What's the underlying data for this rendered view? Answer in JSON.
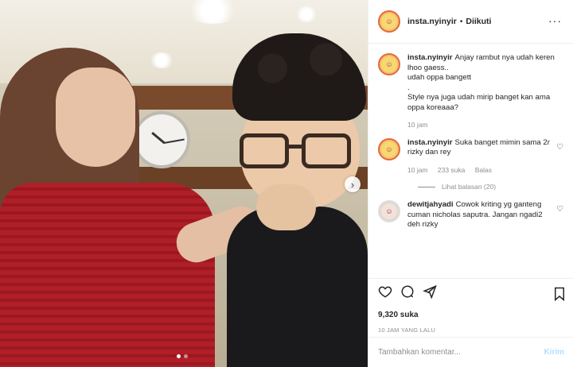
{
  "post": {
    "username": "insta.nyinyir",
    "separator": "•",
    "follow_state": "Diikuti",
    "more_icon": "more-horizontal-icon",
    "caption": "Anjay rambut nya udah keren lhoo gaess..\nudah oppa bangett\n.\nStyle nya juga udah mirip banget kan ama oppa koreaaa?",
    "caption_time": "10 jam",
    "likes": "9,320 suka",
    "posted_ago": "10 JAM YANG LALU"
  },
  "comments": [
    {
      "username": "insta.nyinyir",
      "text": "Suka banget mimin sama 2r rizky dan rey",
      "time": "10 jam",
      "likes": "233 suka",
      "reply_label": "Balas",
      "view_replies": "Lihat balasan (20)"
    },
    {
      "username": "dewitjahyadi",
      "text": "Cowok kriting yg ganteng cuman nicholas saputra. Jangan ngadi2 deh rizky"
    }
  ],
  "composer": {
    "placeholder": "Tambahkan komentar...",
    "post_label": "Kirim"
  },
  "colors": {
    "post_button_disabled": "#b2dffc",
    "secondary_text": "#8e8e8e",
    "dress_red": "#b01f28"
  },
  "icons": [
    "heart-icon",
    "comment-icon",
    "share-icon",
    "bookmark-icon",
    "chevron-right-icon"
  ]
}
